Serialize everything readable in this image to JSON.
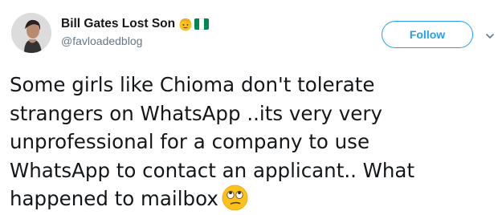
{
  "author": {
    "display_name": "Bill Gates Lost Son",
    "handle": "@favloadedblog",
    "name_emojis": [
      "person-face-emoji",
      "nigeria-flag-emoji"
    ]
  },
  "actions": {
    "follow_label": "Follow",
    "menu_icon": "chevron-down-icon"
  },
  "tweet": {
    "lines": [
      "Some girls like Chioma don't tolerate",
      "strangers on WhatsApp ..its very very",
      "unprofessional for a company to use",
      "WhatsApp to contact an applicant.. What",
      "happened to mailbox"
    ],
    "trailing_emoji": "face-with-rolling-eyes-emoji"
  },
  "colors": {
    "accent": "#1da1f2",
    "text": "#14171a",
    "muted": "#657786",
    "flag_green": "#008751"
  }
}
